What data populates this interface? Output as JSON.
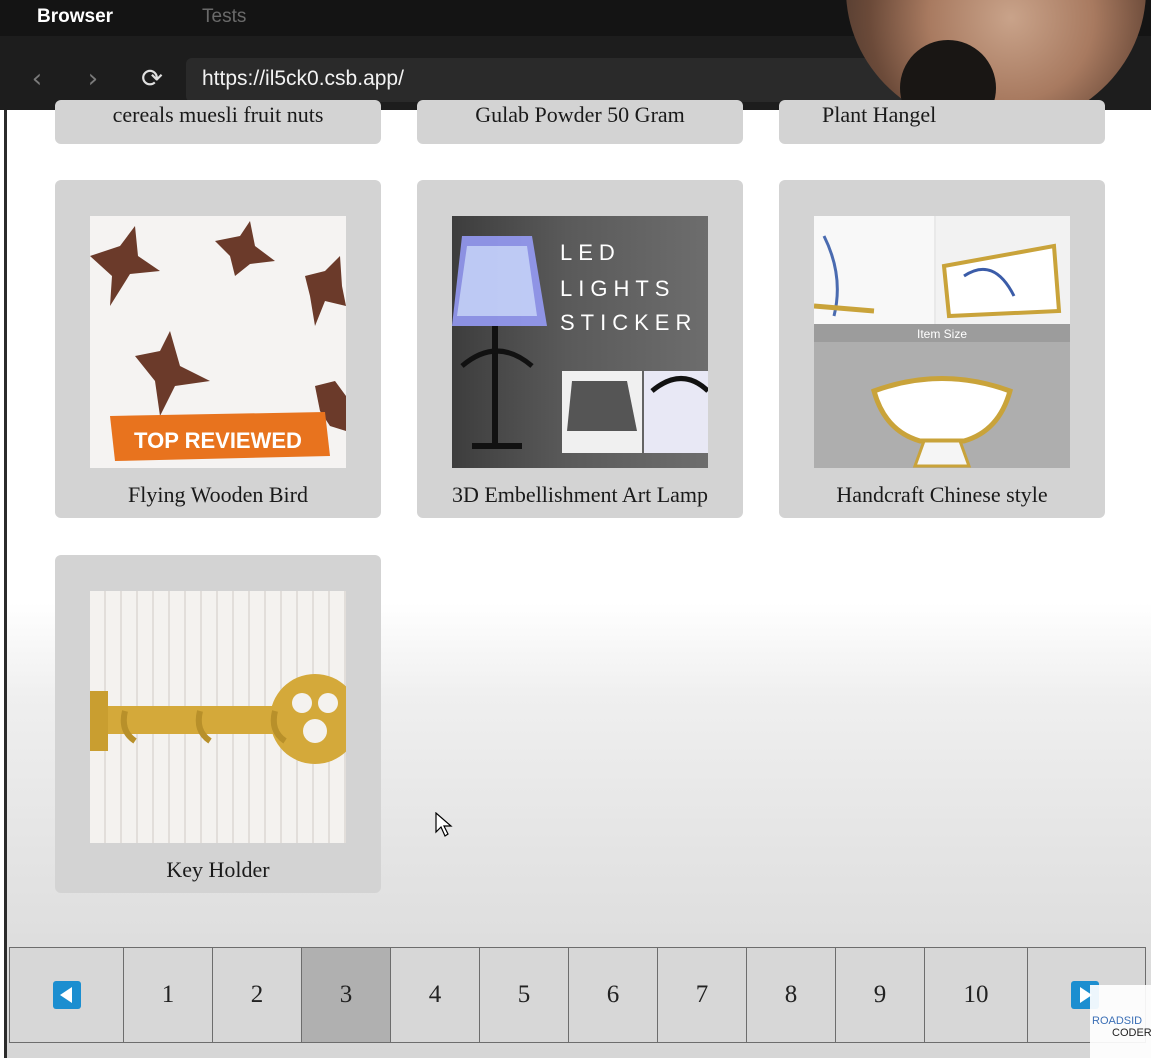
{
  "browser": {
    "tabs": [
      "Browser",
      "Tests"
    ],
    "url": "https://il5ck0.csb.app/"
  },
  "products_top_row": [
    {
      "title": "cereals muesli fruit nuts"
    },
    {
      "title": "Gulab Powder 50 Gram"
    },
    {
      "title": "Plant Hangel"
    }
  ],
  "products": [
    {
      "title": "Flying Wooden Bird",
      "badge": "TOP REVIEWED"
    },
    {
      "title": "3D Embellishment Art Lamp",
      "image_text": [
        "LED",
        "LIGHTS",
        "STICKER"
      ]
    },
    {
      "title": "Handcraft Chinese style",
      "image_text": "Item Size"
    },
    {
      "title": "Key Holder"
    }
  ],
  "pagination": {
    "pages": [
      "1",
      "2",
      "3",
      "4",
      "5",
      "6",
      "7",
      "8",
      "9",
      "10"
    ],
    "active": "3"
  },
  "watermark": {
    "line1": "ROADSID",
    "line2": "CODER"
  },
  "colors": {
    "accent": "#1b8ed0",
    "card": "#d3d3d3",
    "active_page": "#b0b0b0"
  }
}
